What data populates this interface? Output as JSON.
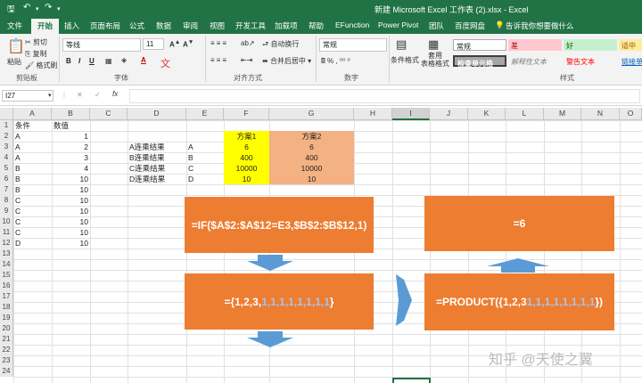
{
  "window": {
    "title": "新建 Microsoft Excel 工作表 (2).xlsx  -  Excel"
  },
  "tabs": [
    "文件",
    "开始",
    "插入",
    "页面布局",
    "公式",
    "数据",
    "审阅",
    "视图",
    "开发工具",
    "加载项",
    "帮助",
    "EFunction",
    "Power Pivot",
    "团队",
    "百度网盘"
  ],
  "tell_me": "告诉我你想要做什么",
  "ribbon": {
    "paste": "粘贴",
    "cut": "剪切",
    "copy": "复制",
    "format_painter": "格式刷",
    "clipboard": "剪贴板",
    "font_name": "等线",
    "font_size": "11",
    "font_group": "字体",
    "wrap": "自动换行",
    "merge": "合并后居中",
    "align_group": "对齐方式",
    "number_format": "常规",
    "number_group": "数字",
    "cond_format": "条件格式",
    "table_format": "套用\n表格格式",
    "styles": {
      "normal": "常规",
      "bad": "差",
      "good": "好",
      "neutral": "适中",
      "check": "检查单元格",
      "explain": "解释性文本",
      "warning": "警告文本",
      "link": "链接单"
    },
    "styles_group": "样式"
  },
  "formula_bar": {
    "name_box": "I27",
    "fx": "fx",
    "formula": ""
  },
  "columns": [
    "A",
    "B",
    "C",
    "D",
    "E",
    "F",
    "G",
    "H",
    "I",
    "J",
    "K",
    "L",
    "M",
    "N",
    "O"
  ],
  "rows": [
    "1",
    "2",
    "3",
    "4",
    "5",
    "6",
    "7",
    "8",
    "9",
    "10",
    "11",
    "12",
    "13",
    "14",
    "15",
    "16",
    "17",
    "18",
    "19",
    "20",
    "21",
    "22",
    "23",
    "24"
  ],
  "sheet": {
    "a_header": "条件",
    "b_header": "数值",
    "a": [
      "A",
      "A",
      "A",
      "B",
      "B",
      "B",
      "C",
      "C",
      "C",
      "C",
      "D"
    ],
    "b": [
      "1",
      "2",
      "3",
      "4",
      "10",
      "10",
      "10",
      "10",
      "10",
      "10",
      "10"
    ],
    "d": [
      "A连乘结果",
      "B连乘结果",
      "C连乘结果",
      "D连乘结果"
    ],
    "e": [
      "A",
      "B",
      "C",
      "D"
    ],
    "f_header": "方案1",
    "f": [
      "6",
      "400",
      "10000",
      "10"
    ],
    "g_header": "方案2",
    "g": [
      "6",
      "400",
      "10000",
      "10"
    ]
  },
  "flow": {
    "box1": "=IF($A$2:$A$12=E3,$B$2:$B$12,1)",
    "box2_prefix": "={1,2,3,",
    "box2_ones": "1,1,1,1,1,1,1,1",
    "box2_suffix": "}",
    "box3_prefix": "=PRODUCT({1,2,3 ",
    "box3_ones": "1,1,1,1,1,1,1,1",
    "box3_suffix": "})",
    "box4": "=6"
  },
  "watermark": "知乎 @天使之翼",
  "colors": {
    "excel_green": "#217346",
    "orange": "#ed7d31",
    "yellow": "#ffff00",
    "salmon": "#f4b183",
    "arrow_blue": "#5b9bd5",
    "muted_ones": "#a9c4eb"
  }
}
